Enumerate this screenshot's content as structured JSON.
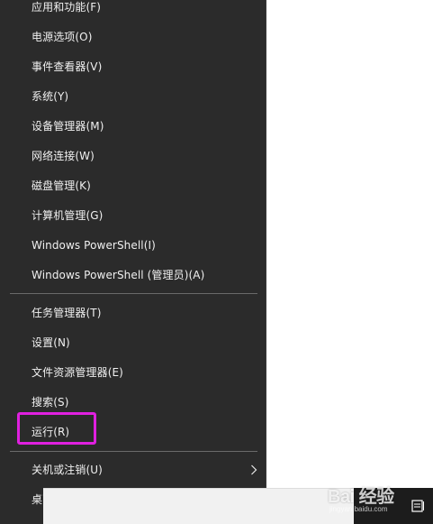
{
  "menu": {
    "items_top": [
      {
        "id": "apps-features",
        "label": "应用和功能(F)"
      },
      {
        "id": "power-options",
        "label": "电源选项(O)"
      },
      {
        "id": "event-viewer",
        "label": "事件查看器(V)"
      },
      {
        "id": "system",
        "label": "系统(Y)"
      },
      {
        "id": "device-manager",
        "label": "设备管理器(M)"
      },
      {
        "id": "network-connections",
        "label": "网络连接(W)"
      },
      {
        "id": "disk-management",
        "label": "磁盘管理(K)"
      },
      {
        "id": "computer-management",
        "label": "计算机管理(G)"
      },
      {
        "id": "powershell",
        "label": "Windows PowerShell(I)"
      },
      {
        "id": "powershell-admin",
        "label": "Windows PowerShell (管理员)(A)"
      }
    ],
    "items_mid": [
      {
        "id": "task-manager",
        "label": "任务管理器(T)"
      },
      {
        "id": "settings",
        "label": "设置(N)"
      },
      {
        "id": "file-explorer",
        "label": "文件资源管理器(E)"
      },
      {
        "id": "search",
        "label": "搜索(S)"
      },
      {
        "id": "run",
        "label": "运行(R)",
        "highlighted": true
      }
    ],
    "items_bottom": [
      {
        "id": "shutdown-signout",
        "label": "关机或注销(U)",
        "has_submenu": true
      },
      {
        "id": "desktop",
        "label": "桌面(D)"
      }
    ]
  },
  "colors": {
    "menu_bg": "#2b2b2b",
    "menu_text": "#f0f0f0",
    "highlight": "#e020e0",
    "separator": "#6a6a6a"
  },
  "watermark": {
    "brand": "Bai 经验",
    "site": "jingyan.baidu.com"
  }
}
